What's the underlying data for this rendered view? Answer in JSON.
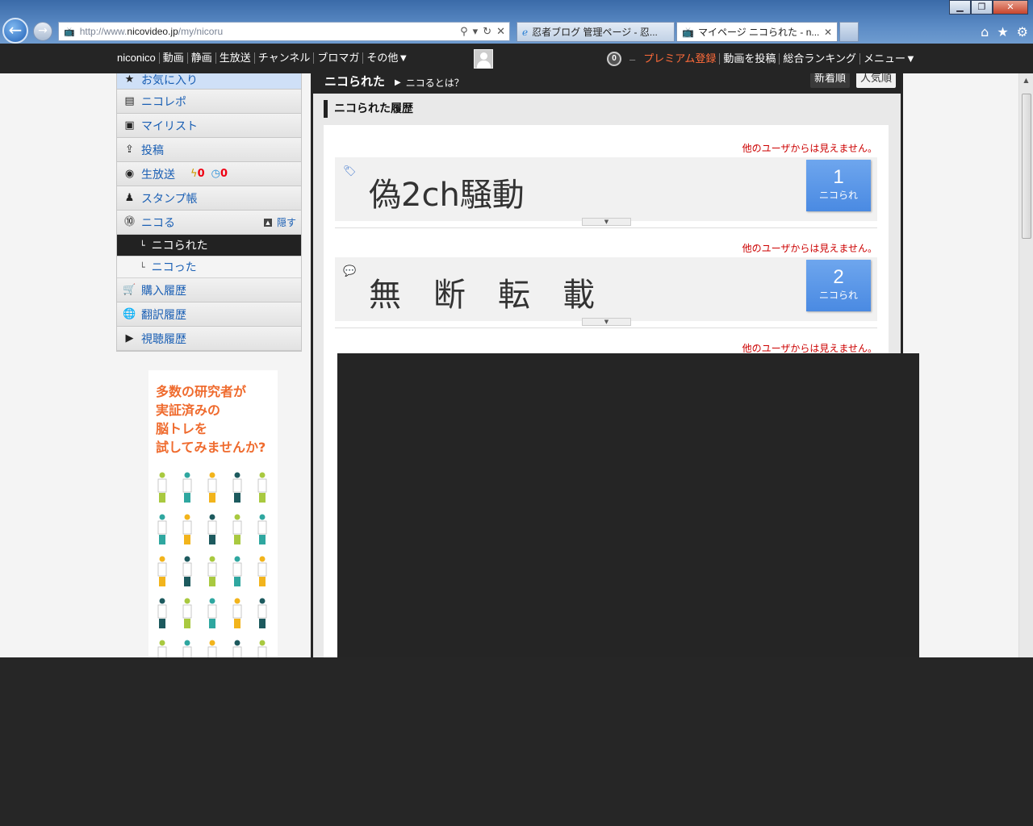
{
  "browser": {
    "url_prefix": "http://www.",
    "url_domain": "nicovideo.jp",
    "url_path": "/my/nicoru",
    "tabs": [
      {
        "label": "忍者ブログ 管理ページ - 忍..."
      },
      {
        "label": "マイページ ニコられた - n..."
      }
    ],
    "back_glyph": "←",
    "forward_glyph": "→"
  },
  "header": {
    "nav": [
      "niconico",
      "動画",
      "静画",
      "生放送",
      "チャンネル",
      "ブロマガ",
      "その他▼"
    ],
    "point": "0",
    "dash": "–",
    "premium": "プレミアム登録",
    "right_links": [
      "動画を投稿",
      "総合ランキング",
      "メニュー▼"
    ]
  },
  "sidebar": {
    "favorite": "お気に入り",
    "items": [
      {
        "label": "ニコレポ",
        "icon": "document-icon"
      },
      {
        "label": "マイリスト",
        "icon": "mylist-icon"
      },
      {
        "label": "投稿",
        "icon": "upload-icon"
      },
      {
        "label": "生放送",
        "icon": "live-icon",
        "live_count": "0",
        "reserve_count": "0"
      },
      {
        "label": "スタンプ帳",
        "icon": "stamp-icon"
      },
      {
        "label": "ニコる",
        "icon": "nicoru-icon",
        "hide": "隠す"
      }
    ],
    "sub_items": [
      {
        "label": "ニコられた"
      },
      {
        "label": "ニコった"
      }
    ],
    "bottom_items": [
      {
        "label": "購入履歴",
        "icon": "cart-icon"
      },
      {
        "label": "翻訳履歴",
        "icon": "globe-icon"
      },
      {
        "label": "視聴履歴",
        "icon": "play-icon"
      }
    ]
  },
  "ad": {
    "text": "多数の研究者が\n実証済みの\n脳トレを\n試してみませんか?"
  },
  "main": {
    "title": "ニコられた",
    "help": "ニコるとは？",
    "sort_new": "新着順",
    "sort_popular": "人気順",
    "section_title": "ニコられた履歴",
    "entries": [
      {
        "note": "他のユーザからは見えません。",
        "title": "偽2ch騒動",
        "count": "1",
        "count_label": "ニコられ",
        "icon": "tag-icon"
      },
      {
        "note": "他のユーザからは見えません。",
        "title": "無　断　転　載",
        "count": "2",
        "count_label": "ニコられ",
        "icon": "comment-icon"
      },
      {
        "note": "他のユーザからは見えません。"
      }
    ]
  },
  "colors": {
    "accent": "#1a5fb4",
    "premium": "#ff6b3a",
    "note": "#cc0000",
    "count_bg": "#5a96e8",
    "ad_text": "#ef6b2e"
  }
}
